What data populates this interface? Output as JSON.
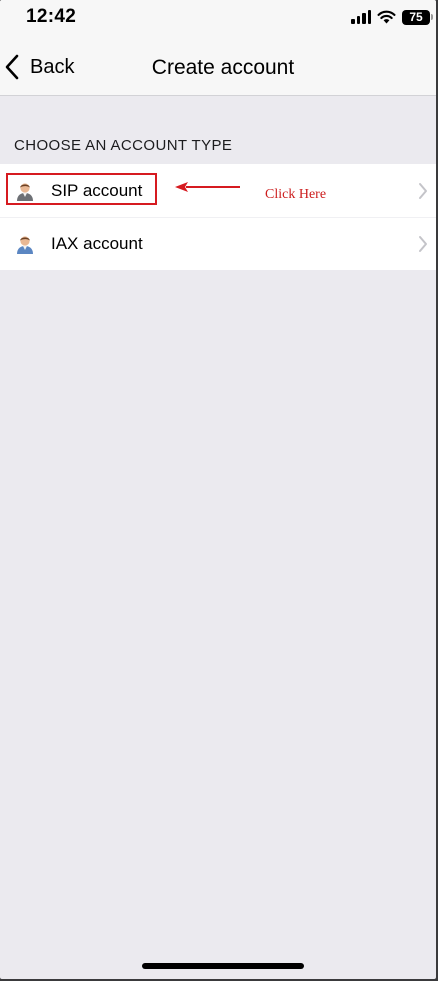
{
  "status_bar": {
    "time": "12:42",
    "battery": "75"
  },
  "nav": {
    "back_label": "Back",
    "title": "Create account"
  },
  "section_header": "CHOOSE AN ACCOUNT TYPE",
  "accounts": [
    {
      "label": "SIP account",
      "icon": "user-icon"
    },
    {
      "label": "IAX account",
      "icon": "user-icon"
    }
  ],
  "annotation": {
    "text": "Click Here",
    "color": "#d61a20"
  }
}
